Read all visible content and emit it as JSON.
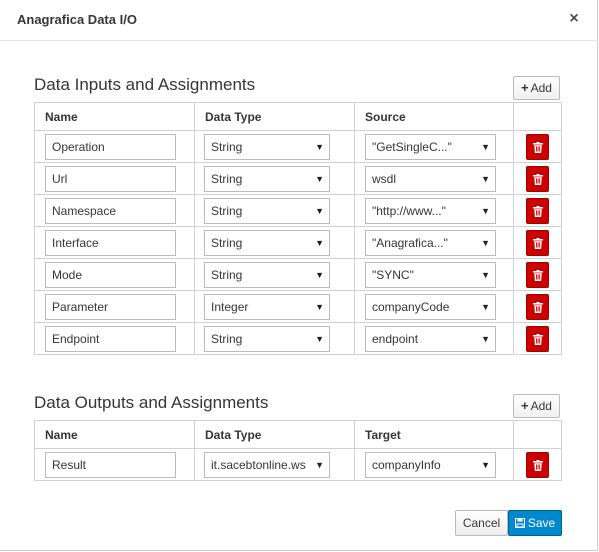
{
  "dialog": {
    "title": "Anagrafica Data I/O",
    "close_glyph": "×"
  },
  "inputs": {
    "title": "Data Inputs and Assignments",
    "add_label": "Add",
    "headers": [
      "Name",
      "Data Type",
      "Source"
    ],
    "rows": [
      {
        "name": "Operation",
        "type": "String",
        "source": "\"GetSingleC...\""
      },
      {
        "name": "Url",
        "type": "String",
        "source": "wsdl"
      },
      {
        "name": "Namespace",
        "type": "String",
        "source": "\"http://www...\""
      },
      {
        "name": "Interface",
        "type": "String",
        "source": "\"Anagrafica...\""
      },
      {
        "name": "Mode",
        "type": "String",
        "source": "\"SYNC\""
      },
      {
        "name": "Parameter",
        "type": "Integer",
        "source": "companyCode"
      },
      {
        "name": "Endpoint",
        "type": "String",
        "source": "endpoint"
      }
    ]
  },
  "outputs": {
    "title": "Data Outputs and Assignments",
    "add_label": "Add",
    "headers": [
      "Name",
      "Data Type",
      "Target"
    ],
    "rows": [
      {
        "name": "Result",
        "type": "it.sacebtonline.ws",
        "target": "companyInfo"
      }
    ]
  },
  "footer": {
    "cancel_label": "Cancel",
    "save_label": "Save"
  },
  "icons": {
    "add": "plus-icon",
    "delete": "trash-icon",
    "save": "floppy-disk-icon",
    "dropdown": "caret-down-icon"
  },
  "colors": {
    "delete_button": "#cc0000",
    "save_button": "#0088ce"
  }
}
